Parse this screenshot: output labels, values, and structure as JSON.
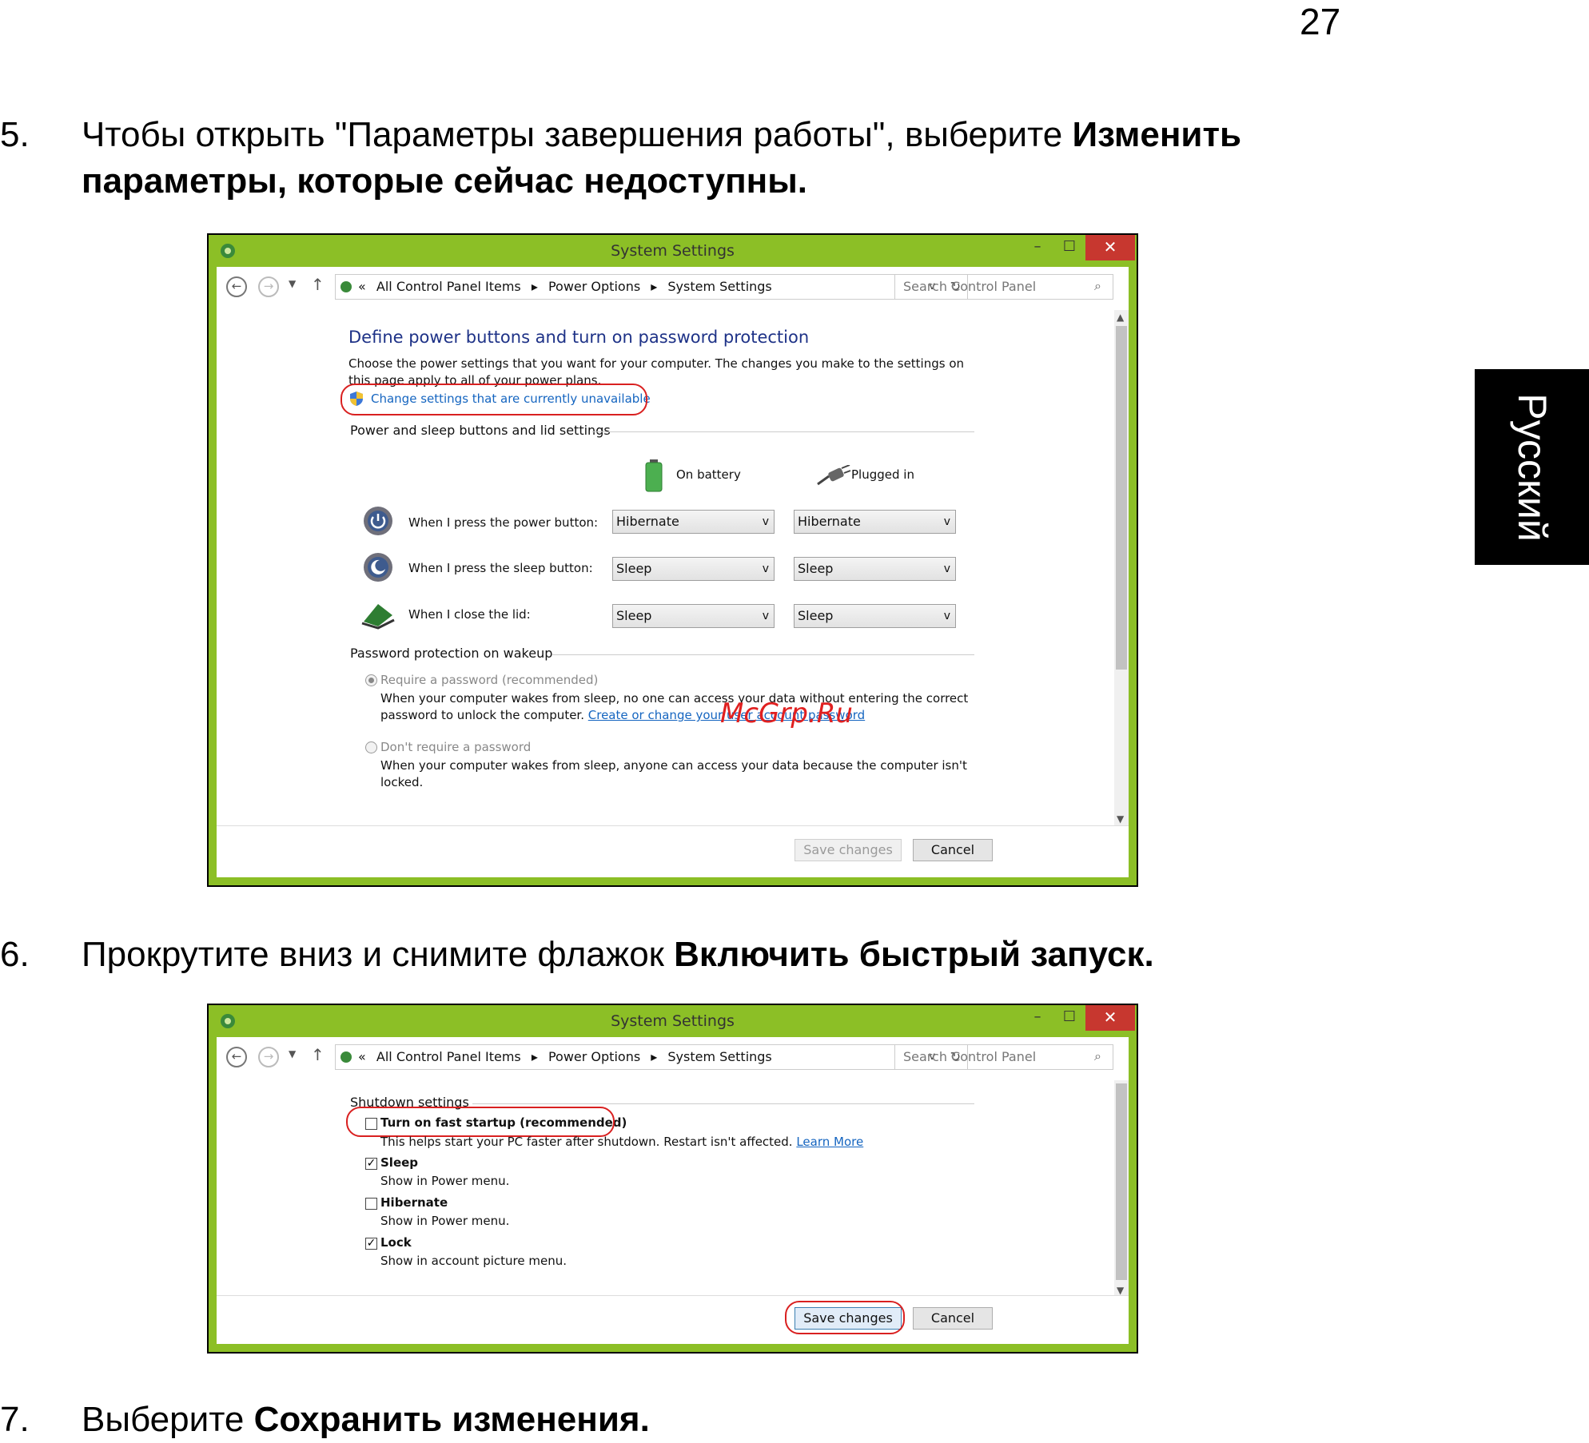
{
  "page": {
    "number": "27",
    "language_tab": "Русский",
    "watermark": "McGrp.Ru",
    "steps": [
      {
        "num": "5.",
        "text": "Чтобы открыть \"Параметры завершения работы\", выберите ",
        "bold": "Изменить параметры, которые сейчас недоступны."
      },
      {
        "num": "6.",
        "text": "Прокрутите вниз и снимите флажок ",
        "bold": "Включить быстрый запуск."
      },
      {
        "num": "7.",
        "text": "Выберите ",
        "bold": "Сохранить изменения."
      }
    ]
  },
  "window": {
    "title": "System Settings",
    "minimize": "–",
    "maximize": "☐",
    "close": "✕",
    "breadcrumb": [
      "«",
      "All Control Panel Items",
      "▸",
      "Power Options",
      "▸",
      "System Settings"
    ],
    "search_placeholder": "Search Control Panel",
    "save_label": "Save changes",
    "cancel_label": "Cancel"
  },
  "screen1": {
    "heading": "Define power buttons and turn on password protection",
    "description": "Choose the power settings that you want for your computer. The changes you make to the settings on this page apply to all of your power plans.",
    "change_link": "Change settings that are currently unavailable",
    "group_buttons": "Power and sleep buttons and lid settings",
    "col_battery": "On battery",
    "col_plugged": "Plugged in",
    "rows": [
      {
        "label": "When I press the power button:",
        "battery": "Hibernate",
        "plugged": "Hibernate"
      },
      {
        "label": "When I press the sleep button:",
        "battery": "Sleep",
        "plugged": "Sleep"
      },
      {
        "label": "When I close the lid:",
        "battery": "Sleep",
        "plugged": "Sleep"
      }
    ],
    "group_password": "Password protection on wakeup",
    "opt_require": "Require a password (recommended)",
    "opt_require_desc": "When your computer wakes from sleep, no one can access your data without entering the correct password to unlock the computer. ",
    "opt_require_link": "Create or change your user account password",
    "opt_norequire": "Don't require a password",
    "opt_norequire_desc": "When your computer wakes from sleep, anyone can access your data because the computer isn't locked."
  },
  "screen2": {
    "group_shutdown": "Shutdown settings",
    "fast_startup": "Turn on fast startup (recommended)",
    "fast_startup_desc": "This helps start your PC faster after shutdown. Restart isn't affected. ",
    "learn_more": "Learn More",
    "items": [
      {
        "label": "Sleep",
        "desc": "Show in Power menu.",
        "checked": true
      },
      {
        "label": "Hibernate",
        "desc": "Show in Power menu.",
        "checked": false
      },
      {
        "label": "Lock",
        "desc": "Show in account picture menu.",
        "checked": true
      }
    ]
  },
  "colors": {
    "window_frame": "#8cbf26",
    "close_button": "#c7372f",
    "highlight": "#d92020",
    "heading": "#1e3287"
  }
}
